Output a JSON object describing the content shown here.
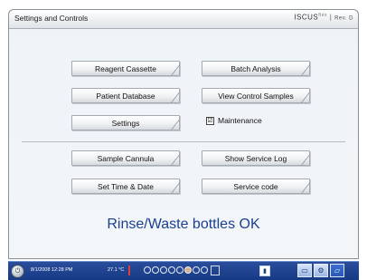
{
  "window": {
    "title": "Settings and Controls",
    "brand": "ISCUS",
    "brand_sup": "flex",
    "brand_sep": "|",
    "brand_version": "Rev. D"
  },
  "buttons": {
    "reagent_cassette": "Reagent Cassette",
    "batch_analysis": "Batch Analysis",
    "patient_database": "Patient Database",
    "view_control_samples": "View Control Samples",
    "settings": "Settings",
    "sample_cannula": "Sample Cannula",
    "show_service_log": "Show Service Log",
    "set_time_date": "Set Time & Date",
    "service_code": "Service code"
  },
  "maintenance": {
    "label": "Maintenance",
    "checked": true,
    "mark": "☑"
  },
  "status_message": "Rinse/Waste bottles OK",
  "taskbar": {
    "datetime": "8/1/2008 12:28 PM",
    "temperature": "27.1 °C"
  }
}
